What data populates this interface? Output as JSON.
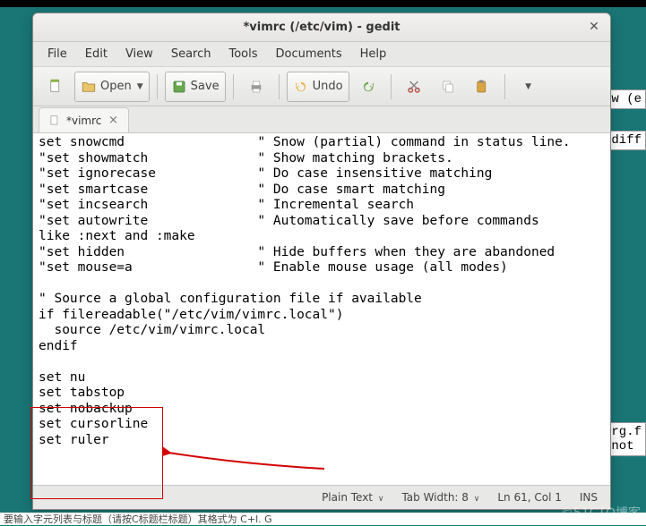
{
  "title": "*vimrc (/etc/vim) - gedit",
  "menubar": {
    "items": [
      "File",
      "Edit",
      "View",
      "Search",
      "Tools",
      "Documents",
      "Help"
    ]
  },
  "toolbar": {
    "open_label": "Open",
    "save_label": "Save",
    "undo_label": "Undo"
  },
  "tab": {
    "label": "*vimrc"
  },
  "editor_text": "set snowcmd                 \" Snow (partial) command in status line.\n\"set showmatch              \" Show matching brackets.\n\"set ignorecase             \" Do case insensitive matching\n\"set smartcase              \" Do case smart matching\n\"set incsearch              \" Incremental search\n\"set autowrite              \" Automatically save before commands\nlike :next and :make\n\"set hidden                 \" Hide buffers when they are abandoned\n\"set mouse=a                \" Enable mouse usage (all modes)\n\n\" Source a global configuration file if available\nif filereadable(\"/etc/vim/vimrc.local\")\n  source /etc/vim/vimrc.local\nendif\n\nset nu\nset tabstop\nset nobackup\nset cursorline\nset ruler\n",
  "statusbar": {
    "syntax": "Plain Text",
    "tabwidth": "Tab Width: 8",
    "position": "Ln 61, Col 1",
    "mode": "INS"
  },
  "bg_fragments": {
    "a": "w (e",
    "b": "diff",
    "c": "rg.f\nnot"
  },
  "watermark": "©51CTO博客",
  "bottom_text": "要输入字元列表与标题（请按C标题栏标题）其格式为 C+l. G"
}
